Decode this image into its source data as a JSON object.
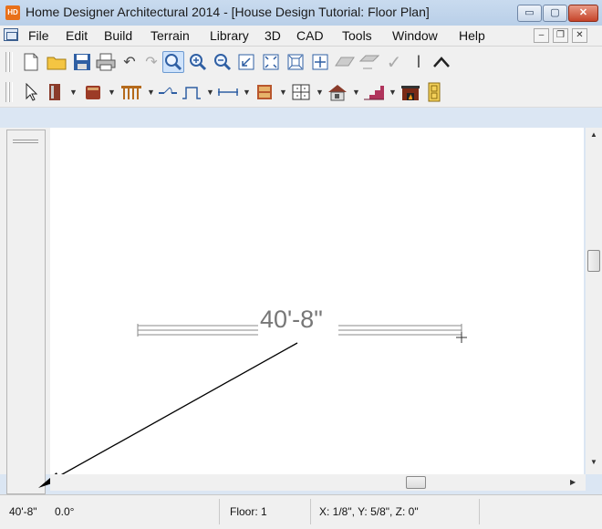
{
  "window": {
    "title": "Home Designer Architectural 2014 - [House Design Tutorial: Floor Plan]",
    "app_icon_label": "HD",
    "minimize_label": "▭",
    "maximize_label": "▢",
    "close_label": "✕"
  },
  "menu": {
    "items": [
      "File",
      "Edit",
      "Build",
      "Terrain",
      "Library",
      "3D",
      "CAD",
      "Tools",
      "Window",
      "Help"
    ],
    "mdi_minimize": "–",
    "mdi_restore": "❐",
    "mdi_close": "✕"
  },
  "toolbar1": {
    "icons": [
      "new-document-icon",
      "open-folder-icon",
      "save-icon",
      "print-icon",
      "undo-icon",
      "redo-icon",
      "zoom-icon",
      "zoom-in-icon",
      "zoom-out-icon",
      "undo-zoom-icon",
      "fill-window-icon",
      "fill-window-building-icon",
      "pan-icon",
      "floor-up-icon",
      "floor-down-icon",
      "checkmark-icon",
      "line-icon",
      "up-arrow-icon"
    ]
  },
  "toolbar2": {
    "icons": [
      "select-objects-icon",
      "wall-tools-icon",
      "cabinet-tools-icon",
      "railing-tools-icon",
      "door-tools-icon",
      "window-tools-icon",
      "dimension-tools-icon",
      "room-tools-icon",
      "library-tools-icon",
      "roof-tools-icon",
      "stair-tools-icon",
      "fireplace-tools-icon",
      "text-tools-icon"
    ]
  },
  "canvas": {
    "dimension_text": "40'-8\""
  },
  "status": {
    "length": "40'-8\"",
    "angle": "0.0°",
    "floor": "Floor: 1",
    "coordinates": "X: 1/8\", Y: 5/8\", Z: 0\""
  },
  "colors": {
    "titlebar": "#c9dbef",
    "close_button": "#c6442a",
    "app_icon": "#e8701a",
    "dimension_line": "#777777",
    "annotation_arrow": "#000000"
  }
}
